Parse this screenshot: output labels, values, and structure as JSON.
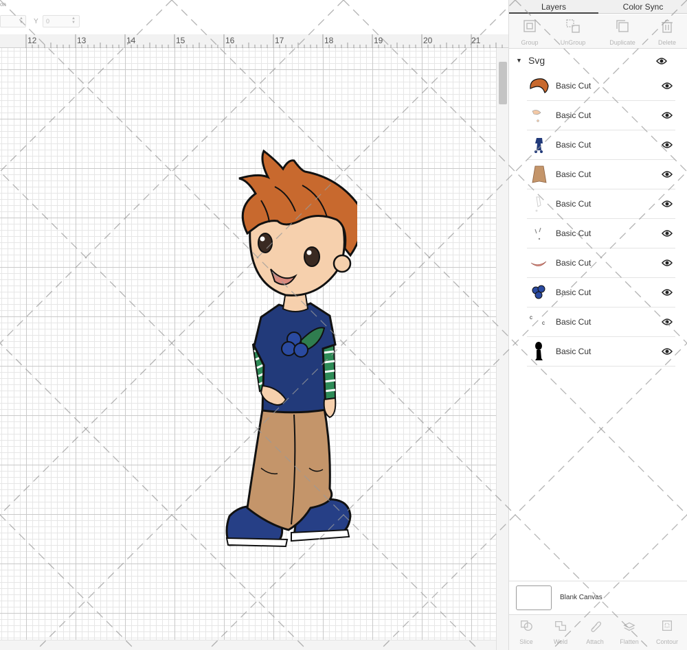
{
  "position": {
    "label": "on",
    "x_value": "",
    "y_label": "Y",
    "y_value": "0"
  },
  "ruler": {
    "labels": [
      "12",
      "13",
      "14",
      "15",
      "16",
      "17",
      "18",
      "19",
      "20",
      "21"
    ]
  },
  "panel": {
    "tabs": [
      {
        "label": "Layers",
        "active": true
      },
      {
        "label": "Color Sync",
        "active": false
      }
    ],
    "toolbar": [
      {
        "label": "Group",
        "icon": "group-icon"
      },
      {
        "label": "UnGroup",
        "icon": "ungroup-icon"
      },
      {
        "label": "Duplicate",
        "icon": "duplicate-icon"
      },
      {
        "label": "Delete",
        "icon": "trash-icon"
      }
    ],
    "group": {
      "name": "Svg"
    },
    "layers": [
      {
        "name": "Basic Cut",
        "thumb": "hair",
        "color": "#c8692e"
      },
      {
        "name": "Basic Cut",
        "thumb": "skin",
        "color": "#f3c9a6"
      },
      {
        "name": "Basic Cut",
        "thumb": "shirt-navy",
        "color": "#223a7a"
      },
      {
        "name": "Basic Cut",
        "thumb": "pants",
        "color": "#c4956a"
      },
      {
        "name": "Basic Cut",
        "thumb": "white-details",
        "color": "#e8e8e8"
      },
      {
        "name": "Basic Cut",
        "thumb": "gray-details",
        "color": "#8a8a8a"
      },
      {
        "name": "Basic Cut",
        "thumb": "mouth",
        "color": "#d98a7e"
      },
      {
        "name": "Basic Cut",
        "thumb": "berries",
        "color": "#2a4aa0"
      },
      {
        "name": "Basic Cut",
        "thumb": "tiny-marks",
        "color": "#222222"
      },
      {
        "name": "Basic Cut",
        "thumb": "black-outline",
        "color": "#000000"
      }
    ],
    "blank_canvas_label": "Blank Canvas",
    "bottom_tools": [
      {
        "label": "Slice",
        "icon": "slice-icon"
      },
      {
        "label": "Weld",
        "icon": "weld-icon"
      },
      {
        "label": "Attach",
        "icon": "attach-icon"
      },
      {
        "label": "Flatten",
        "icon": "flatten-icon"
      },
      {
        "label": "Contour",
        "icon": "contour-icon"
      }
    ]
  },
  "colors": {
    "hair": "#c8692e",
    "skin": "#f6d0ad",
    "shirt": "#223a7a",
    "sleeve_green": "#2e8b57",
    "pants": "#c4956a",
    "shoes": "#263f86",
    "leaf": "#2f7d4f",
    "outline": "#111111"
  }
}
